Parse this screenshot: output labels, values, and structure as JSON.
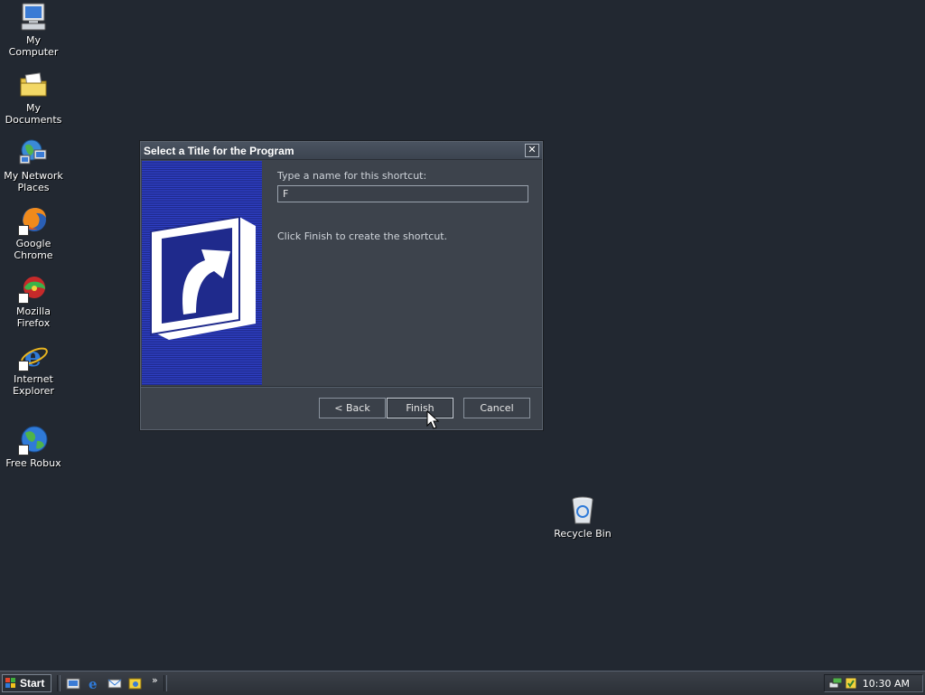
{
  "desktop": {
    "icons": [
      {
        "label": "My Computer"
      },
      {
        "label": "My Documents"
      },
      {
        "label": "My Network Places"
      },
      {
        "label": "Google Chrome"
      },
      {
        "label": "Mozilla Firefox"
      },
      {
        "label": "Internet Explorer"
      },
      {
        "label": "Free Robux"
      },
      {
        "label": "Recycle Bin"
      }
    ]
  },
  "dialog": {
    "title": "Select a Title for the Program",
    "close_glyph": "✕",
    "name_label": "Type a name for this shortcut:",
    "name_value": "F",
    "hint": "Click Finish to create the shortcut.",
    "back_label": "< Back",
    "finish_label": "Finish",
    "cancel_label": "Cancel"
  },
  "taskbar": {
    "start_label": "Start",
    "more_glyph": "»",
    "clock": "10:30 AM"
  },
  "colors": {
    "desktop_bg": "#222831",
    "wizard_art_blue": "#2e3fc4"
  }
}
